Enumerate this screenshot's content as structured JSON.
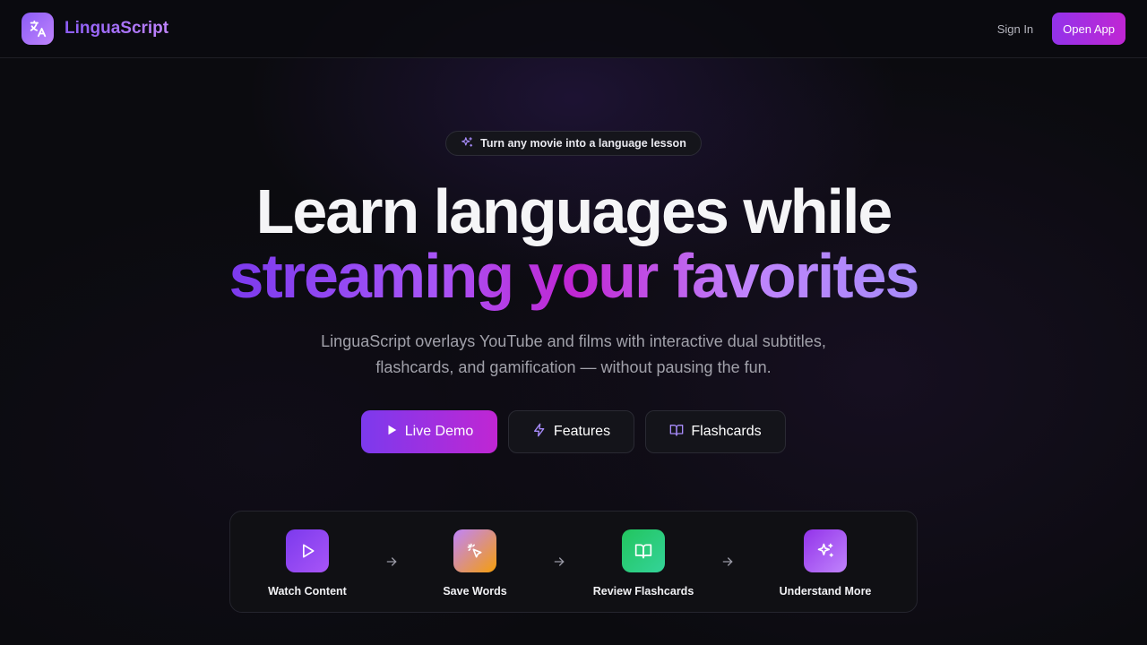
{
  "header": {
    "brand_name": "LinguaScript",
    "logo_icon": "translate-icon",
    "signin_label": "Sign In",
    "open_app_label": "Open App"
  },
  "hero": {
    "badge_icon": "sparkles-icon",
    "badge_text": "Turn any movie into a language lesson",
    "headline_line1": "Learn languages while",
    "headline_line2": "streaming your favorites",
    "subtitle_line1": "LinguaScript overlays YouTube and films with interactive dual subtitles,",
    "subtitle_line2": "flashcards, and gamification — without pausing the fun."
  },
  "cta": {
    "live_demo": {
      "label": "Live Demo",
      "icon": "play-icon"
    },
    "features": {
      "label": "Features",
      "icon": "lightning-icon"
    },
    "flashcards": {
      "label": "Flashcards",
      "icon": "book-open-icon"
    }
  },
  "steps": [
    {
      "label": "Watch Content",
      "icon": "play-icon",
      "color": "#8b5cf6"
    },
    {
      "label": "Save Words",
      "icon": "cursor-click-icon",
      "color": "#f59e0b"
    },
    {
      "label": "Review Flashcards",
      "icon": "book-open-icon",
      "color": "#22c55e"
    },
    {
      "label": "Understand More",
      "icon": "sparkles-icon",
      "color": "#a855f7"
    }
  ],
  "colors": {
    "accent": "#8b5cf6",
    "accent_pink": "#c026d3",
    "background": "#0b0b0f"
  }
}
